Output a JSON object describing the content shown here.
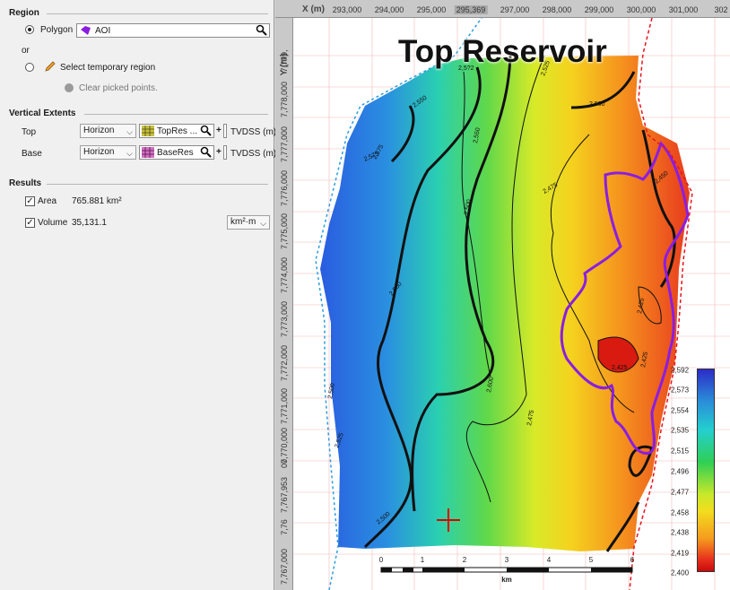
{
  "region": {
    "title": "Region",
    "polygon_label": "Polygon",
    "polygon_value": "AOI",
    "or_label": "or",
    "temp_region_label": "Select temporary region",
    "clear_label": "Clear picked points."
  },
  "vertical": {
    "title": "Vertical Extents",
    "top_label": "Top",
    "top_type": "Horizon",
    "top_value": "TopRes ...",
    "top_unit": "TVDSS (m)",
    "base_label": "Base",
    "base_type": "Horizon",
    "base_value": "BaseRes",
    "base_unit": "TVDSS (m)",
    "plus": "+"
  },
  "results": {
    "title": "Results",
    "area_label": "Area",
    "area_value": "765.881 km²",
    "volume_label": "Volume",
    "volume_value": "35,131.1",
    "volume_unit": "km²·m"
  },
  "map": {
    "title": "Top Reservoir",
    "x_axis_label": "X (m)",
    "y_axis_label": "Y (m)",
    "x_ticks": [
      "293,000",
      "294,000",
      "295,000",
      "295,369",
      "297,000",
      "298,000",
      "299,000",
      "300,000",
      "301,000",
      "302"
    ],
    "y_ticks": [
      "7,779,",
      "7,778,000",
      "7,777,000",
      "7,776,000",
      "7,775,000",
      "7,774,000",
      "7,773,000",
      "7,772,000",
      "7,771,000",
      "7,770,000",
      "00",
      "7,767,953",
      "7,76",
      "7,767,000"
    ],
    "contour_labels": [
      "2,5?2",
      "2,550",
      "2,575",
      "2,525",
      "2,500",
      "2,550",
      "2,500",
      "2,475",
      "2,450",
      "2,425",
      "2,425",
      "2,425",
      "2,560",
      "2,600",
      "2,475",
      "2,525",
      "2,500",
      "2,575",
      "2,500"
    ],
    "legend_ticks": [
      "2,592",
      "2,573",
      "2,554",
      "2,535",
      "2,515",
      "2,496",
      "2,477",
      "2,458",
      "2,438",
      "2,419",
      "2,400"
    ],
    "scale_ticks": [
      "0",
      "1",
      "2",
      "3",
      "4",
      "5",
      "6"
    ],
    "scale_unit": "km"
  },
  "colors": {
    "polygon": "#8a1ee0",
    "contour": "#111111",
    "boundary": "#2a9de0",
    "fault": "#e8141e"
  },
  "icons": [
    "radio-selected-icon",
    "radio-unselected-icon",
    "polygon-icon",
    "magnifier-icon",
    "pencil-icon",
    "grid-icon",
    "checkbox-checked-icon"
  ]
}
